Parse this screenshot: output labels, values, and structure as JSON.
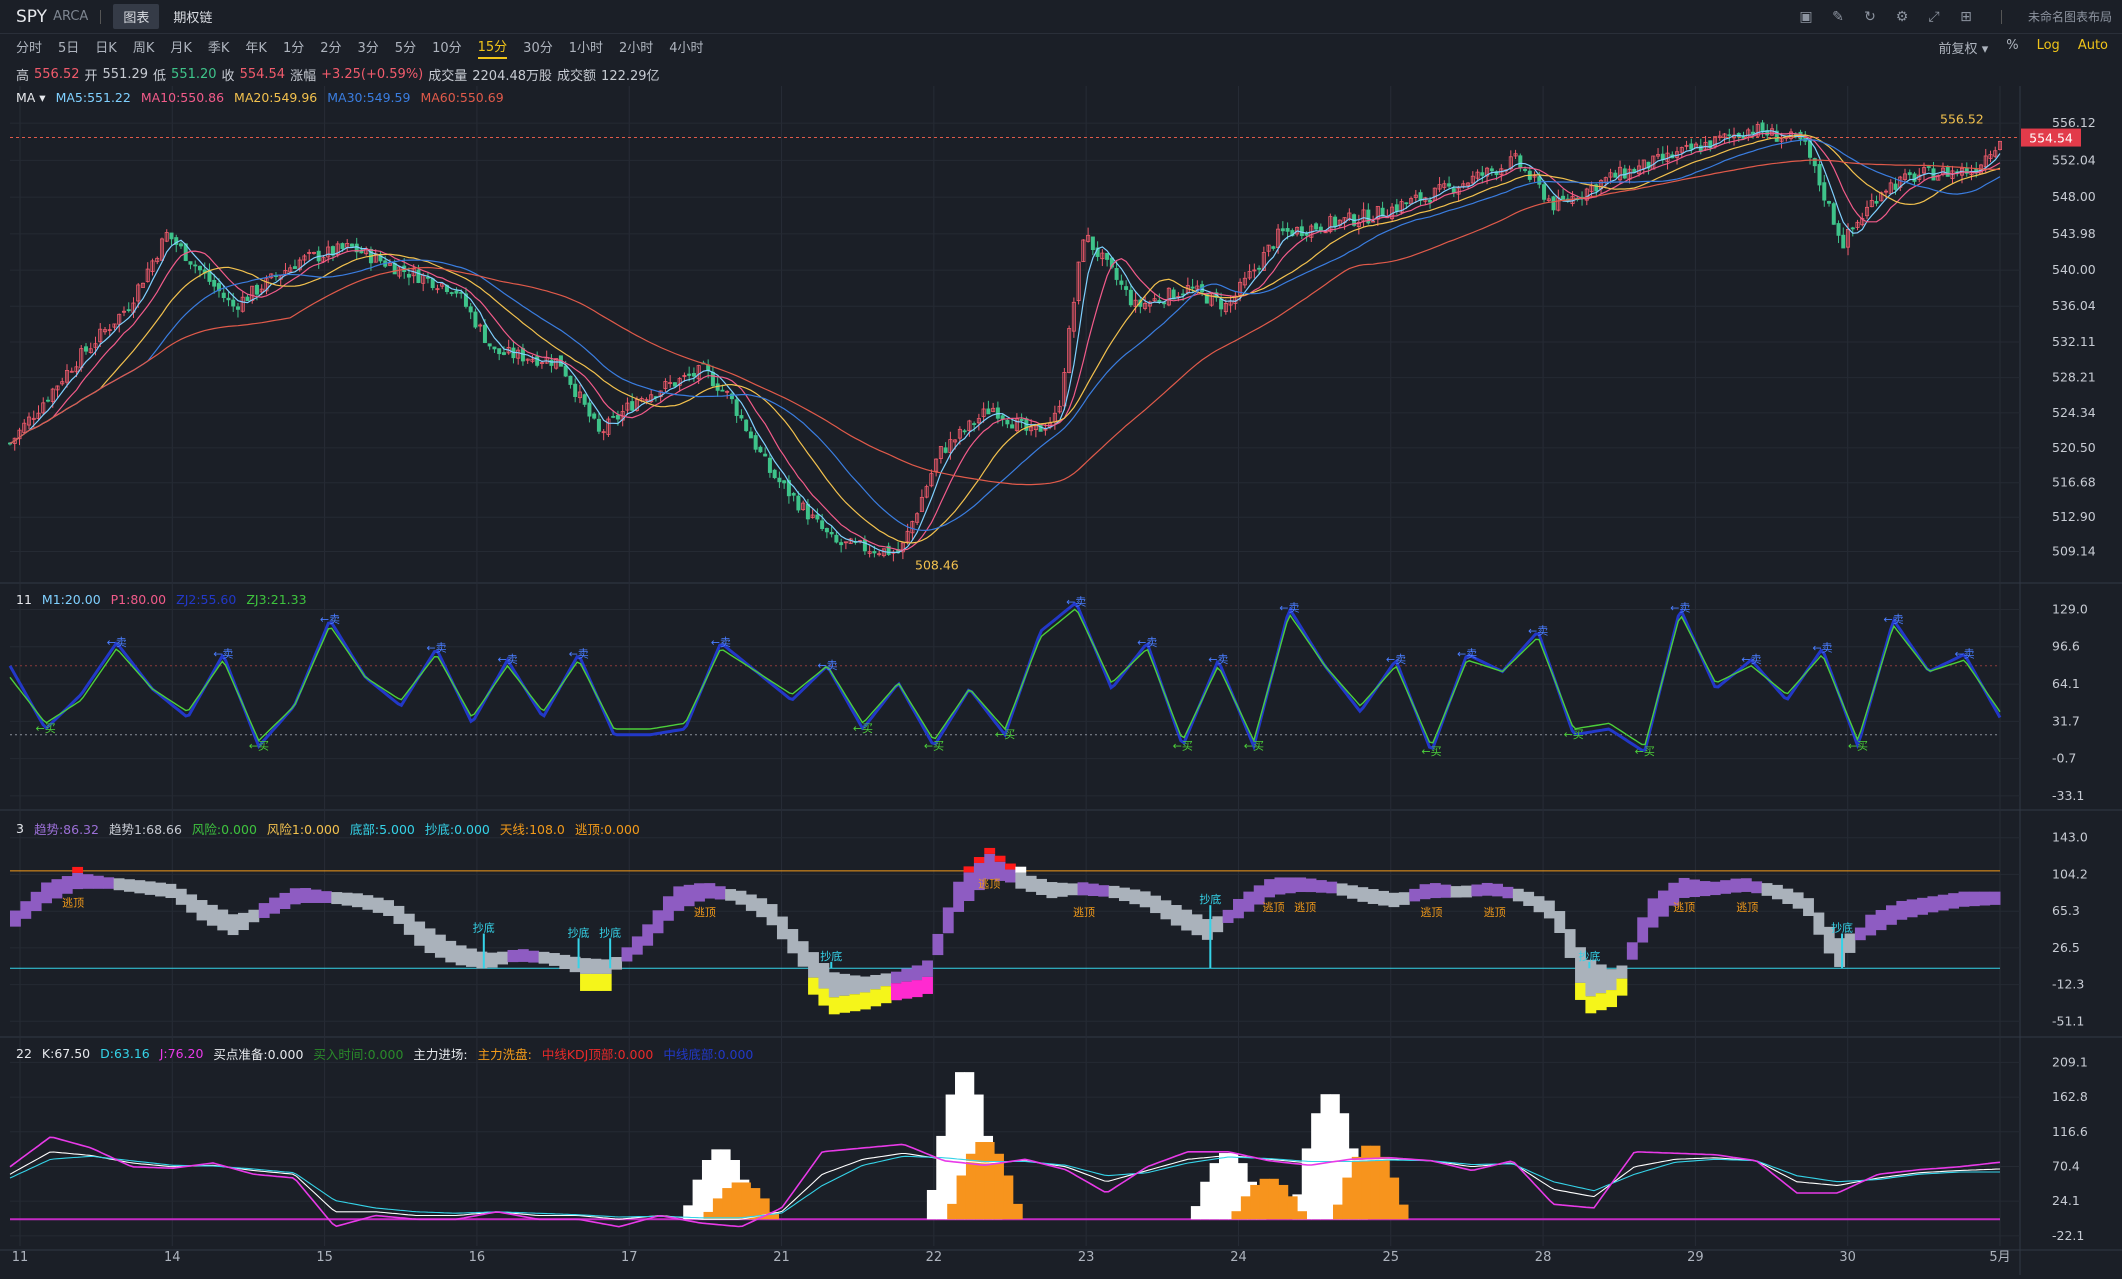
{
  "header": {
    "symbol": "SPY",
    "exchange": "ARCA",
    "tabs": [
      {
        "label": "图表",
        "active": true
      },
      {
        "label": "期权链",
        "active": false
      }
    ],
    "layout_label": "未命名图表布局"
  },
  "periods": {
    "items": [
      "分时",
      "5日",
      "日K",
      "周K",
      "月K",
      "季K",
      "年K",
      "1分",
      "2分",
      "3分",
      "5分",
      "10分",
      "15分",
      "30分",
      "1小时",
      "2小时",
      "4小时"
    ],
    "active": "15分",
    "right": [
      "前复权",
      "%",
      "Log",
      "Auto"
    ]
  },
  "quote": {
    "high_label": "高",
    "high": "556.52",
    "open_label": "开",
    "open": "551.29",
    "low_label": "低",
    "low": "551.20",
    "close_label": "收",
    "close": "554.54",
    "change_label": "涨幅",
    "change": "+3.25(+0.59%)",
    "volume_label": "成交量",
    "volume": "2204.48万股",
    "amount_label": "成交额",
    "amount": "122.29亿"
  },
  "colors": {
    "up": "#f15b6c",
    "down": "#3ec38a",
    "bg": "#1b1f27",
    "ma5": "#7fd0ff",
    "ma10": "#f25b8a",
    "ma20": "#f2c14e",
    "ma30": "#3a7de0",
    "ma60": "#e05a4a"
  },
  "chart_data": [
    {
      "type": "candlestick",
      "pane": "price",
      "indicator": "MA",
      "legend": [
        "MA5:551.22",
        "MA10:550.86",
        "MA20:549.96",
        "MA30:549.59",
        "MA60:550.69"
      ],
      "yticks": [
        "556.12",
        "552.04",
        "548.00",
        "543.98",
        "540.00",
        "536.04",
        "532.11",
        "528.21",
        "524.34",
        "520.50",
        "516.68",
        "512.90",
        "509.14"
      ],
      "ylim": [
        507,
        558
      ],
      "current_price": "554.54",
      "max_label": "556.52",
      "min_label": "508.46",
      "xticks": [
        "11",
        "14",
        "15",
        "16",
        "17",
        "21",
        "22",
        "23",
        "24",
        "25",
        "28",
        "29",
        "30",
        "5月"
      ],
      "anchors": [
        {
          "t": 0,
          "v": 521
        },
        {
          "t": 5,
          "v": 530
        },
        {
          "t": 9,
          "v": 536
        },
        {
          "t": 12,
          "v": 544
        },
        {
          "t": 17,
          "v": 536
        },
        {
          "t": 22,
          "v": 541
        },
        {
          "t": 26,
          "v": 542.5
        },
        {
          "t": 30,
          "v": 540
        },
        {
          "t": 34,
          "v": 538
        },
        {
          "t": 37,
          "v": 531
        },
        {
          "t": 42,
          "v": 530
        },
        {
          "t": 45,
          "v": 522
        },
        {
          "t": 48,
          "v": 526
        },
        {
          "t": 53,
          "v": 529
        },
        {
          "t": 55,
          "v": 526
        },
        {
          "t": 58,
          "v": 518
        },
        {
          "t": 63,
          "v": 510
        },
        {
          "t": 68,
          "v": 509
        },
        {
          "t": 71,
          "v": 520
        },
        {
          "t": 75,
          "v": 525
        },
        {
          "t": 78,
          "v": 522
        },
        {
          "t": 80,
          "v": 524
        },
        {
          "t": 82,
          "v": 544
        },
        {
          "t": 86,
          "v": 536
        },
        {
          "t": 90,
          "v": 538
        },
        {
          "t": 93,
          "v": 536
        },
        {
          "t": 97,
          "v": 544
        },
        {
          "t": 104,
          "v": 546
        },
        {
          "t": 110,
          "v": 549
        },
        {
          "t": 115,
          "v": 552
        },
        {
          "t": 118,
          "v": 547
        },
        {
          "t": 122,
          "v": 550
        },
        {
          "t": 128,
          "v": 553
        },
        {
          "t": 133,
          "v": 555.5
        },
        {
          "t": 137,
          "v": 554
        },
        {
          "t": 140,
          "v": 543
        },
        {
          "t": 143,
          "v": 549
        },
        {
          "t": 146,
          "v": 550.5
        },
        {
          "t": 150,
          "v": 551
        },
        {
          "t": 152,
          "v": 554.5
        }
      ]
    },
    {
      "type": "line",
      "pane": "oscillator",
      "id": "11",
      "legend": [
        "M1:20.00",
        "P1:80.00",
        "ZJ2:55.60",
        "ZJ3:21.33"
      ],
      "yticks": [
        "129.0",
        "96.6",
        "64.1",
        "31.7",
        "-0.7",
        "-33.1"
      ],
      "ylim": [
        -35,
        132
      ],
      "levels": [
        20,
        80
      ],
      "sell_marker": "卖",
      "buy_marker": "买",
      "series": [
        {
          "name": "ZJ2",
          "values": [
            80,
            25,
            55,
            100,
            60,
            35,
            90,
            10,
            45,
            120,
            70,
            45,
            95,
            30,
            85,
            35,
            90,
            20,
            20,
            25,
            100,
            75,
            50,
            80,
            25,
            65,
            10,
            60,
            20,
            110,
            135,
            60,
            100,
            10,
            85,
            10,
            130,
            80,
            40,
            85,
            5,
            90,
            75,
            110,
            20,
            25,
            5,
            130,
            60,
            85,
            50,
            95,
            10,
            120,
            75,
            90,
            35
          ]
        },
        {
          "name": "ZJ3",
          "values": [
            70,
            30,
            50,
            95,
            60,
            40,
            85,
            15,
            45,
            115,
            70,
            50,
            90,
            35,
            80,
            40,
            85,
            25,
            25,
            30,
            95,
            75,
            55,
            80,
            30,
            65,
            15,
            60,
            25,
            105,
            130,
            65,
            95,
            15,
            80,
            15,
            125,
            80,
            45,
            80,
            10,
            85,
            75,
            105,
            25,
            30,
            10,
            125,
            65,
            80,
            55,
            90,
            15,
            115,
            75,
            85,
            40
          ]
        }
      ]
    },
    {
      "type": "area",
      "pane": "trend",
      "id": "3",
      "legend": [
        "趋势:86.32",
        "趋势1:68.66",
        "风险:0.000",
        "风险1:0.000",
        "底部:5.000",
        "抄底:0.000",
        "天线:108.0",
        "逃顶:0.000"
      ],
      "yticks": [
        "143.0",
        "104.2",
        "65.3",
        "26.5",
        "-12.3",
        "-51.1"
      ],
      "ylim": [
        -55,
        148
      ],
      "levels": [
        108,
        5
      ],
      "escape_label": "逃顶",
      "bottom_label": "抄底",
      "series": [
        {
          "name": "趋势",
          "values": [
            60,
            90,
            100,
            95,
            90,
            85,
            60,
            45,
            70,
            85,
            80,
            75,
            65,
            30,
            15,
            10,
            20,
            15,
            5,
            5,
            40,
            85,
            90,
            80,
            60,
            15,
            -20,
            -15,
            -5,
            5,
            90,
            120,
            95,
            85,
            90,
            85,
            75,
            55,
            40,
            75,
            95,
            95,
            90,
            80,
            75,
            90,
            85,
            90,
            80,
            60,
            -20,
            -10,
            70,
            95,
            90,
            95,
            85,
            70,
            10,
            55,
            70,
            75,
            80,
            80
          ]
        },
        {
          "name": "趋势1",
          "values": [
            55,
            80,
            95,
            95,
            92,
            88,
            70,
            55,
            65,
            80,
            80,
            78,
            70,
            45,
            25,
            15,
            18,
            16,
            10,
            8,
            30,
            70,
            85,
            82,
            70,
            30,
            -5,
            -10,
            -5,
            0,
            70,
            105,
            100,
            90,
            88,
            86,
            80,
            65,
            50,
            65,
            88,
            92,
            90,
            84,
            78,
            85,
            86,
            88,
            82,
            68,
            10,
            -5,
            50,
            85,
            88,
            92,
            88,
            76,
            30,
            45,
            62,
            70,
            76,
            78
          ]
        }
      ]
    },
    {
      "type": "line",
      "pane": "kdj",
      "id": "22",
      "legend": [
        "K:67.50",
        "D:63.16",
        "J:76.20",
        "买点准备:0.000",
        "买入时间:0.000",
        "主力进场:",
        "主力洗盘:",
        "中线KDJ顶部:0.000",
        "中线底部:0.000"
      ],
      "yticks": [
        "209.1",
        "162.8",
        "116.6",
        "70.4",
        "24.1",
        "-22.1"
      ],
      "ylim": [
        -25,
        215
      ],
      "series": [
        {
          "name": "K",
          "values": [
            60,
            90,
            85,
            75,
            70,
            72,
            65,
            60,
            10,
            10,
            5,
            5,
            10,
            5,
            5,
            0,
            5,
            0,
            0,
            10,
            60,
            80,
            88,
            80,
            75,
            78,
            70,
            50,
            65,
            80,
            85,
            80,
            75,
            78,
            80,
            78,
            70,
            75,
            40,
            30,
            70,
            80,
            82,
            78,
            50,
            45,
            55,
            62,
            65,
            67
          ]
        },
        {
          "name": "D",
          "values": [
            55,
            80,
            84,
            78,
            72,
            71,
            67,
            62,
            25,
            15,
            10,
            8,
            10,
            8,
            6,
            3,
            4,
            2,
            2,
            8,
            45,
            72,
            84,
            82,
            77,
            77,
            72,
            58,
            62,
            75,
            83,
            81,
            77,
            77,
            79,
            78,
            73,
            74,
            50,
            38,
            60,
            76,
            80,
            78,
            58,
            50,
            53,
            60,
            63,
            63
          ]
        },
        {
          "name": "J",
          "values": [
            70,
            110,
            95,
            70,
            68,
            75,
            60,
            55,
            -10,
            5,
            0,
            0,
            10,
            0,
            0,
            -10,
            5,
            -5,
            -10,
            15,
            90,
            95,
            100,
            78,
            72,
            80,
            66,
            35,
            70,
            90,
            90,
            78,
            72,
            80,
            82,
            78,
            65,
            78,
            20,
            15,
            90,
            88,
            86,
            78,
            35,
            35,
            60,
            66,
            70,
            76
          ]
        },
        {
          "name": "主力进场",
          "values": [
            0,
            0,
            0,
            0,
            0,
            0,
            0,
            0,
            0,
            0,
            0,
            0,
            0,
            0,
            0,
            0,
            0,
            0,
            0,
            0,
            0,
            0,
            0,
            0,
            0,
            0,
            0,
            0,
            0,
            0,
            0,
            0,
            0,
            0,
            0,
            0,
            0,
            0,
            0,
            0,
            0,
            0,
            0,
            0,
            0,
            0,
            0,
            0,
            0,
            0
          ]
        }
      ],
      "white_blocks": [
        {
          "x": 17.5,
          "h": 95
        },
        {
          "x": 23.5,
          "h": 200
        },
        {
          "x": 30,
          "h": 90
        },
        {
          "x": 32.5,
          "h": 170
        }
      ],
      "orange_blocks": [
        {
          "x": 18,
          "h": 50
        },
        {
          "x": 24,
          "h": 105
        },
        {
          "x": 31,
          "h": 55
        },
        {
          "x": 33.5,
          "h": 100
        }
      ]
    }
  ]
}
